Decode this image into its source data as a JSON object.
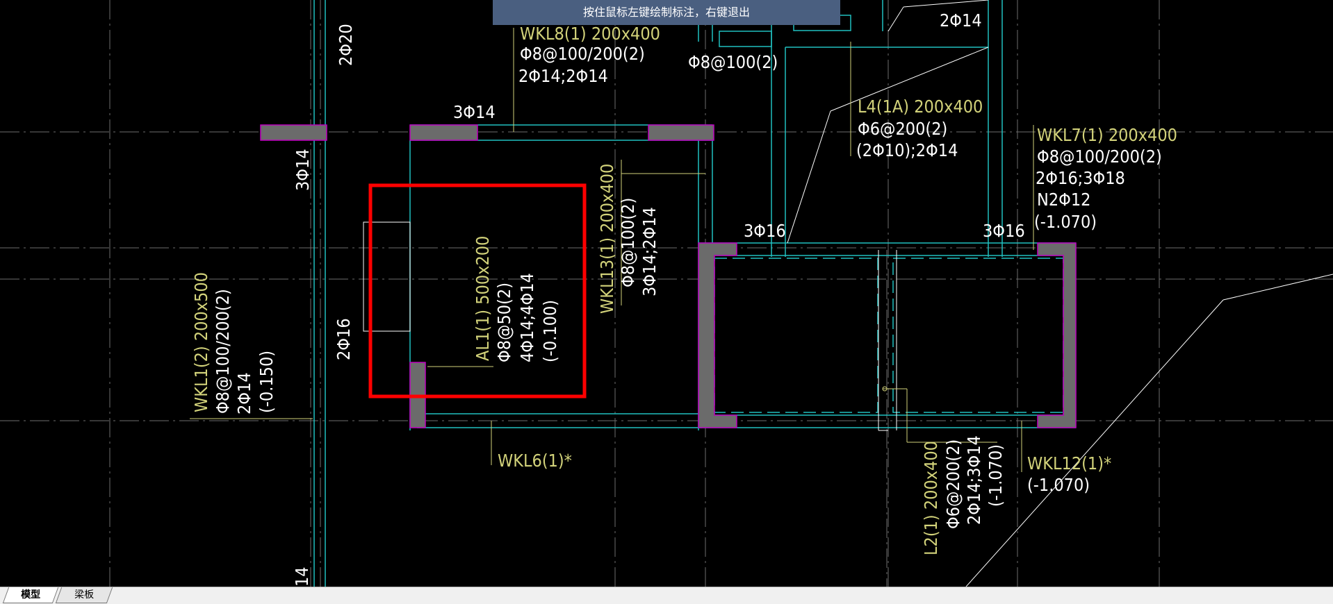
{
  "status_banner": "按住鼠标左键绘制标注，右键退出",
  "tabs": [
    {
      "label": "模型"
    },
    {
      "label": "梁板"
    }
  ],
  "beam_annotations": {
    "wkl8": {
      "name": "WKL8(1) 200x400",
      "stirrup": "Φ8@100/200(2)",
      "rebar": "2Φ14;2Φ14"
    },
    "wkl8_top_phi": "3Φ14",
    "top_phi8": "Φ8@100(2)",
    "top_right_2phi14": "2Φ14",
    "l4": {
      "name": "L4(1A) 200x400",
      "stirrup": "Φ6@200(2)",
      "rebar": "(2Φ10);2Φ14"
    },
    "wkl7": {
      "name": "WKL7(1) 200x400",
      "stirrup": "Φ8@100/200(2)",
      "rebar": "2Φ16;3Φ18",
      "extra": "N2Φ12",
      "elev": "(-1.070)"
    },
    "col_3phi16_a": "3Φ16",
    "col_3phi16_b": "3Φ16",
    "wkl13": {
      "name": "WKL13(1) 200x400",
      "stirrup": "Φ8@100(2)",
      "rebar": "3Φ14;2Φ14"
    },
    "al1": {
      "name": "AL1(1) 500x200",
      "stirrup": "Φ8@50(2)",
      "rebar": "4Φ14;4Φ14",
      "elev": "(-0.100)"
    },
    "wkl1": {
      "name": "WKL1(2) 200x500",
      "stirrup": "Φ8@100/200(2)",
      "rebar": "2Φ14",
      "elev": "(-0.150)"
    },
    "vert_2phi20": "2Φ20",
    "vert_3phi14": "3Φ14",
    "vert_2phi16": "2Φ16",
    "vert_bottom_14": "14",
    "wkl6": "WKL6(1)*",
    "wkl12": {
      "name": "WKL12(1)*",
      "elev": "(-1.070)"
    },
    "l2": {
      "name": "L2(1) 200x400",
      "stirrup": "Φ6@200(2)",
      "rebar": "2Φ14;3Φ14",
      "elev": "(-1.070)"
    }
  },
  "colors": {
    "background": "#000000",
    "cyan_lines": "#20c0c0",
    "grid_lines": "#6e6e6e",
    "label_yellow": "#d2d27a",
    "label_white": "#ffffff",
    "column_fill": "#6b6b6b",
    "column_outline": "#c000c0",
    "selection_box": "#ff0000",
    "banner_bg": "#4a5f80"
  }
}
